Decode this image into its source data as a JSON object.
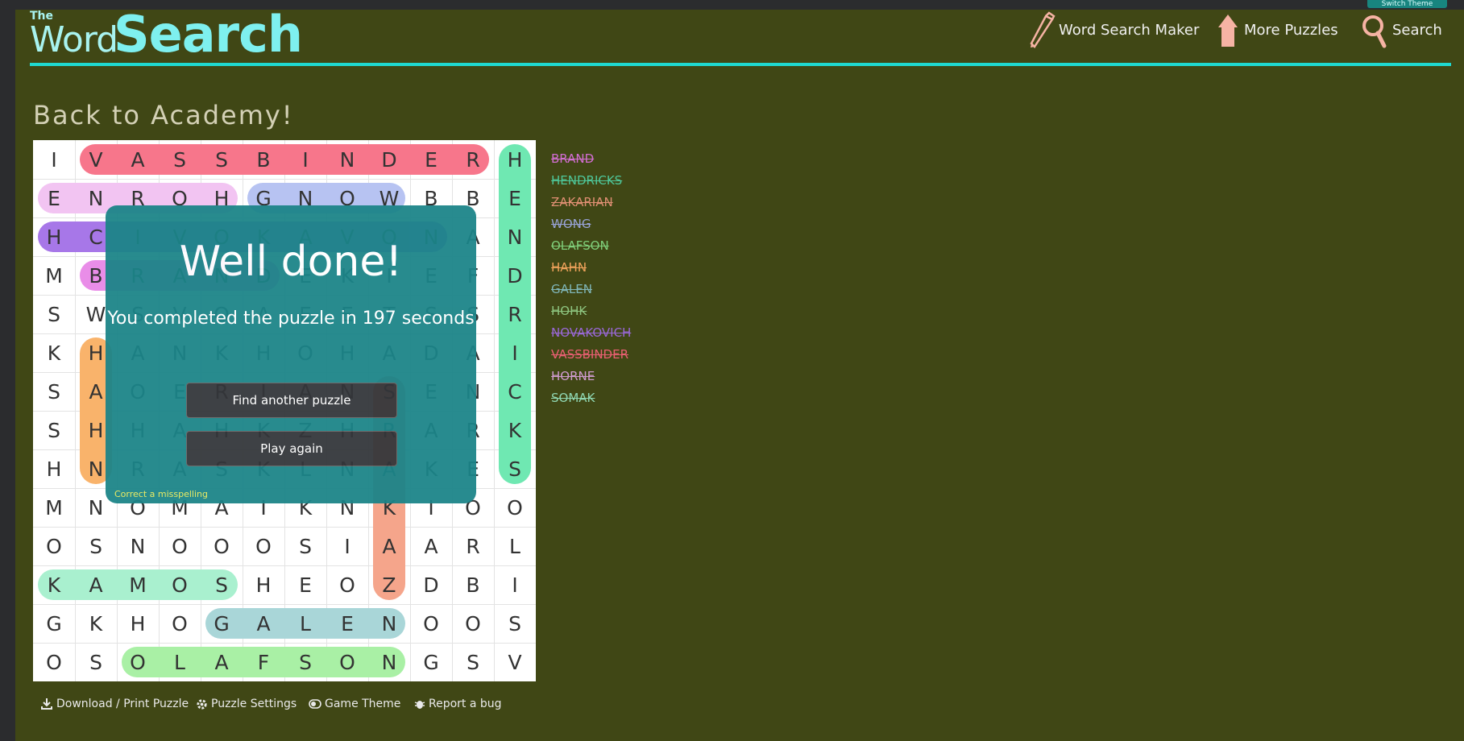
{
  "switch_theme": "Switch Theme",
  "logo": {
    "the": "The",
    "word": "Word",
    "search": "Search"
  },
  "nav": {
    "maker": "Word Search Maker",
    "more": "More Puzzles",
    "search": "Search"
  },
  "puzzle_title": "Back to Academy!",
  "grid": [
    [
      "I",
      "V",
      "A",
      "S",
      "S",
      "B",
      "I",
      "N",
      "D",
      "E",
      "R",
      "H"
    ],
    [
      "E",
      "N",
      "R",
      "O",
      "H",
      "G",
      "N",
      "O",
      "W",
      "B",
      "B",
      "E"
    ],
    [
      "H",
      "C",
      "I",
      "V",
      "O",
      "K",
      "A",
      "V",
      "O",
      "N",
      "A",
      "N"
    ],
    [
      "M",
      "B",
      "R",
      "A",
      "N",
      "D",
      "E",
      "K",
      "I",
      "E",
      "F",
      "D"
    ],
    [
      "S",
      "W",
      "S",
      "V",
      "O",
      "A",
      "E",
      "E",
      "T",
      "S",
      "S",
      "R"
    ],
    [
      "K",
      "H",
      "A",
      "N",
      "K",
      "H",
      "O",
      "H",
      "A",
      "D",
      "A",
      "I"
    ],
    [
      "S",
      "A",
      "O",
      "E",
      "R",
      "I",
      "A",
      "N",
      "S",
      "E",
      "N",
      "C"
    ],
    [
      "S",
      "H",
      "H",
      "A",
      "H",
      "K",
      "Z",
      "H",
      "R",
      "A",
      "R",
      "K"
    ],
    [
      "H",
      "N",
      "R",
      "A",
      "S",
      "K",
      "L",
      "N",
      "A",
      "K",
      "E",
      "S"
    ],
    [
      "M",
      "N",
      "O",
      "M",
      "A",
      "I",
      "K",
      "N",
      "K",
      "I",
      "O",
      "O"
    ],
    [
      "O",
      "S",
      "N",
      "O",
      "O",
      "O",
      "S",
      "I",
      "A",
      "A",
      "R",
      "L"
    ],
    [
      "K",
      "A",
      "M",
      "O",
      "S",
      "H",
      "E",
      "O",
      "Z",
      "D",
      "B",
      "I"
    ],
    [
      "G",
      "K",
      "H",
      "O",
      "G",
      "A",
      "L",
      "E",
      "N",
      "O",
      "O",
      "S"
    ],
    [
      "O",
      "S",
      "O",
      "L",
      "A",
      "F",
      "S",
      "O",
      "N",
      "G",
      "S",
      "V"
    ]
  ],
  "highlights": [
    {
      "row": 0,
      "col": 1,
      "len": 10,
      "dir": "h",
      "color": "#f7768b"
    },
    {
      "row": 0,
      "col": 11,
      "len": 9,
      "dir": "v",
      "color": "#6fe8b2"
    },
    {
      "row": 1,
      "col": 0,
      "len": 5,
      "dir": "h",
      "color": "#f2c4f2"
    },
    {
      "row": 1,
      "col": 5,
      "len": 4,
      "dir": "h",
      "color": "#b7c3f2"
    },
    {
      "row": 2,
      "col": 0,
      "len": 10,
      "dir": "h",
      "color": "#a777e8"
    },
    {
      "row": 3,
      "col": 1,
      "len": 5,
      "dir": "h",
      "color": "#e98de8"
    },
    {
      "row": 5,
      "col": 1,
      "len": 4,
      "dir": "v",
      "color": "#f9b36b"
    },
    {
      "row": 6,
      "col": 8,
      "len": 6,
      "dir": "v",
      "color": "#f5a58b"
    },
    {
      "row": 11,
      "col": 0,
      "len": 5,
      "dir": "h",
      "color": "#a9f0cf"
    },
    {
      "row": 12,
      "col": 4,
      "len": 5,
      "dir": "h",
      "color": "#a9d6d8"
    },
    {
      "row": 13,
      "col": 2,
      "len": 7,
      "dir": "h",
      "color": "#a9f0a5"
    }
  ],
  "overlay": {
    "title": "Well done!",
    "message": "You completed the puzzle in 197 seconds",
    "find_another": "Find another puzzle",
    "play_again": "Play again",
    "misspelling": "Correct a misspelling"
  },
  "words": [
    {
      "text": "BRAND",
      "color": "#d36ed3"
    },
    {
      "text": "HENDRICKS",
      "color": "#4ec79a"
    },
    {
      "text": "ZAKARIAN",
      "color": "#df8f73"
    },
    {
      "text": "WONG",
      "color": "#98a3d6"
    },
    {
      "text": "OLAFSON",
      "color": "#7fcf7a"
    },
    {
      "text": "HAHN",
      "color": "#f0a35b"
    },
    {
      "text": "GALEN",
      "color": "#7fb5b7"
    },
    {
      "text": "HOHK",
      "color": "#8dc47f"
    },
    {
      "text": "NOVAKOVICH",
      "color": "#9a68d8"
    },
    {
      "text": "VASSBINDER",
      "color": "#ea5f73"
    },
    {
      "text": "HORNE",
      "color": "#cf9bcf"
    },
    {
      "text": "SOMAK",
      "color": "#8fd6b1"
    }
  ],
  "footer": {
    "download": "Download / Print Puzzle",
    "settings": "Puzzle Settings",
    "theme": "Game Theme",
    "bug": "Report a bug"
  }
}
